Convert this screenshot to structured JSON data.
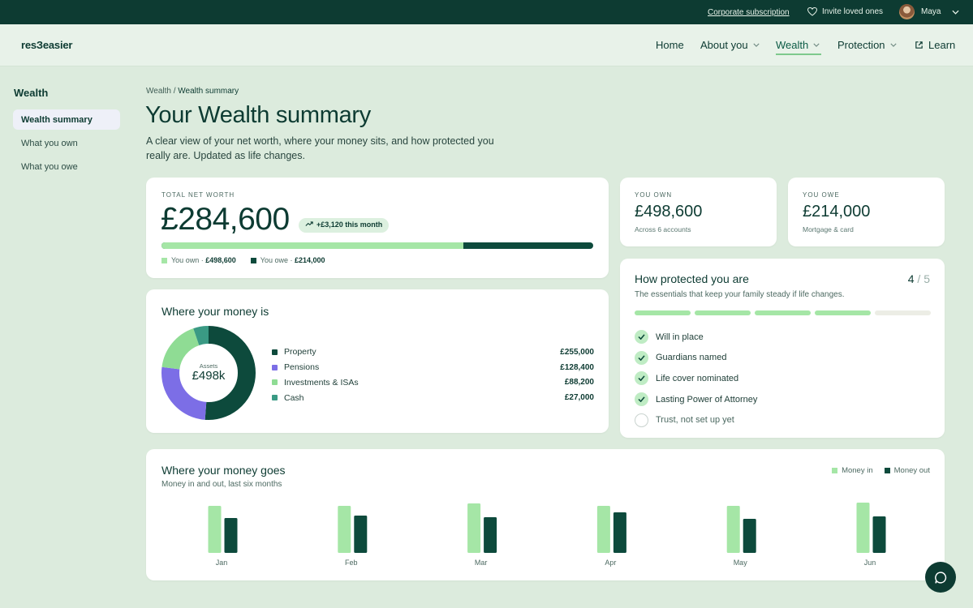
{
  "topbar": {
    "corporate_link": "Corporate subscription",
    "invite_link": "Invite loved ones",
    "user_name": "Maya"
  },
  "nav": {
    "logo_text": "res?easier",
    "items": [
      {
        "label": "Home",
        "has_chevron": false
      },
      {
        "label": "About you",
        "has_chevron": true
      },
      {
        "label": "Wealth",
        "has_chevron": true,
        "active": true
      },
      {
        "label": "Protection",
        "has_chevron": true
      },
      {
        "label": "Learn",
        "icon": "external-link-icon"
      }
    ]
  },
  "sidebar": {
    "title": "Wealth",
    "items": [
      {
        "label": "Wealth summary",
        "active": true
      },
      {
        "label": "What you own"
      },
      {
        "label": "What you owe"
      }
    ]
  },
  "breadcrumb": {
    "parent": "Wealth",
    "separator": " / ",
    "current": "Wealth summary"
  },
  "page": {
    "title": "Your Wealth summary",
    "subtitle": "A clear view of your net worth, where your money sits, and how protected you really are. Updated as life changes."
  },
  "net_worth": {
    "label": "TOTAL NET WORTH",
    "value": "£284,600",
    "change": "+£3,120 this month",
    "own_fraction": 0.7,
    "own_label": "You own ·",
    "own_value": "£498,600",
    "owe_label": "You owe ·",
    "owe_value": "£214,000"
  },
  "own_card": {
    "label": "YOU OWN",
    "value": "£498,600",
    "note": "Across 6 accounts"
  },
  "owe_card": {
    "label": "YOU OWE",
    "value": "£214,000",
    "note": "Mortgage & card"
  },
  "protection": {
    "title": "How protected you are",
    "subtitle": "The essentials that keep your family steady if life changes.",
    "score": "4",
    "score_total": " / 5",
    "segments": [
      true,
      true,
      true,
      true,
      false
    ],
    "items": [
      {
        "label": "Will in place",
        "done": true
      },
      {
        "label": "Guardians named",
        "done": true
      },
      {
        "label": "Life cover nominated",
        "done": true
      },
      {
        "label": "Lasting Power of Attorney",
        "done": true
      },
      {
        "label": "Trust, not set up yet",
        "done": false
      }
    ]
  },
  "where_money": {
    "title": "Where your money is",
    "center_label": "Assets",
    "center_value": "£498k",
    "assets": [
      {
        "name": "Property",
        "value": "£255,000",
        "amount": 255000,
        "color": "#0d4a3c"
      },
      {
        "name": "Pensions",
        "value": "£128,400",
        "amount": 128400,
        "color": "#7c6ee6"
      },
      {
        "name": "Investments & ISAs",
        "value": "£88,200",
        "amount": 88200,
        "color": "#8fdc94"
      },
      {
        "name": "Cash",
        "value": "£27,000",
        "amount": 27000,
        "color": "#3a9a84"
      }
    ]
  },
  "money_goes": {
    "title": "Where your money goes",
    "subtitle": "Money in and out, last six months",
    "legend_in": "Money in",
    "legend_out": "Money out",
    "color_in": "#a5e6a6",
    "color_out": "#0d4a3c"
  },
  "chart_data": {
    "type": "bar",
    "categories": [
      "Jan",
      "Feb",
      "Mar",
      "Apr",
      "May",
      "Jun"
    ],
    "series": [
      {
        "name": "Money in",
        "values": [
          58,
          58,
          61,
          58,
          58,
          62
        ]
      },
      {
        "name": "Money out",
        "values": [
          43,
          46,
          44,
          50,
          42,
          45
        ]
      }
    ],
    "ylim": [
      0,
      70
    ],
    "title": "Where your money goes",
    "xlabel": "",
    "ylabel": ""
  }
}
